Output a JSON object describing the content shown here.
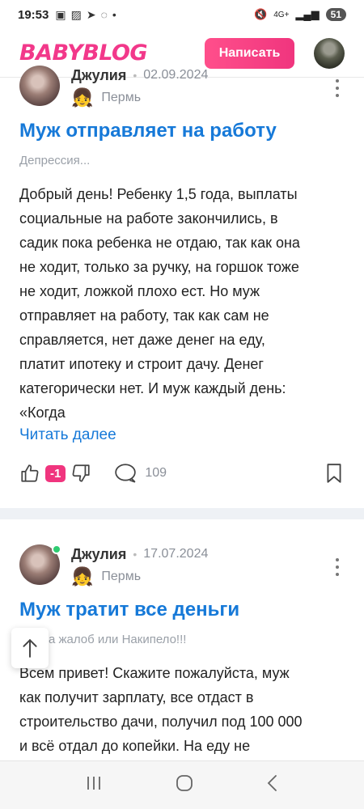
{
  "status_bar": {
    "time": "19:53",
    "notif_icons": [
      "screenshot-icon",
      "image-icon",
      "telegram-icon",
      "whatsapp-icon"
    ],
    "dot": "•",
    "network": "4G+",
    "battery": "51"
  },
  "header": {
    "logo": "BABYBLOG",
    "write_button": "Написать"
  },
  "posts": [
    {
      "author": "Джулия",
      "date": "02.09.2024",
      "city": "Пермь",
      "title": "Муж отправляет на работу",
      "category": "Депрессия...",
      "body_lines": [
        "Добрый день! Ребенку 1,5 года, выплаты",
        "социальные на работе закончились, в",
        "садик пока ребенка не отдаю, так как она",
        "не ходит, только за ручку, на горшок тоже",
        "не ходит, ложкой плохо ест. Но муж",
        "отправляет на работу, так как сам не",
        "справляется, нет даже денег на еду,",
        "платит ипотеку и строит дачу. Денег",
        "категорически нет. И муж каждый день:",
        "«Когда"
      ],
      "read_more": "Читать далее",
      "rating": "-1",
      "comments": "109"
    },
    {
      "author": "Джулия",
      "date": "17.07.2024",
      "city": "Пермь",
      "title": "Муж тратит все деньги",
      "category": "Книга жалоб или Накипело!!!",
      "category_visible": "а жалоб или Накипело!!!",
      "body_lines": [
        "Всем привет! Скажите пожалуйста, муж",
        "как получит зарплату, все отдаст в",
        "строительство дачи, получил под 100 000",
        "и всё отдал до копейки. На еду не"
      ]
    }
  ],
  "colors": {
    "brand_pink": "#f2388a",
    "link_blue": "#1679d8",
    "muted": "#8a8f98"
  }
}
